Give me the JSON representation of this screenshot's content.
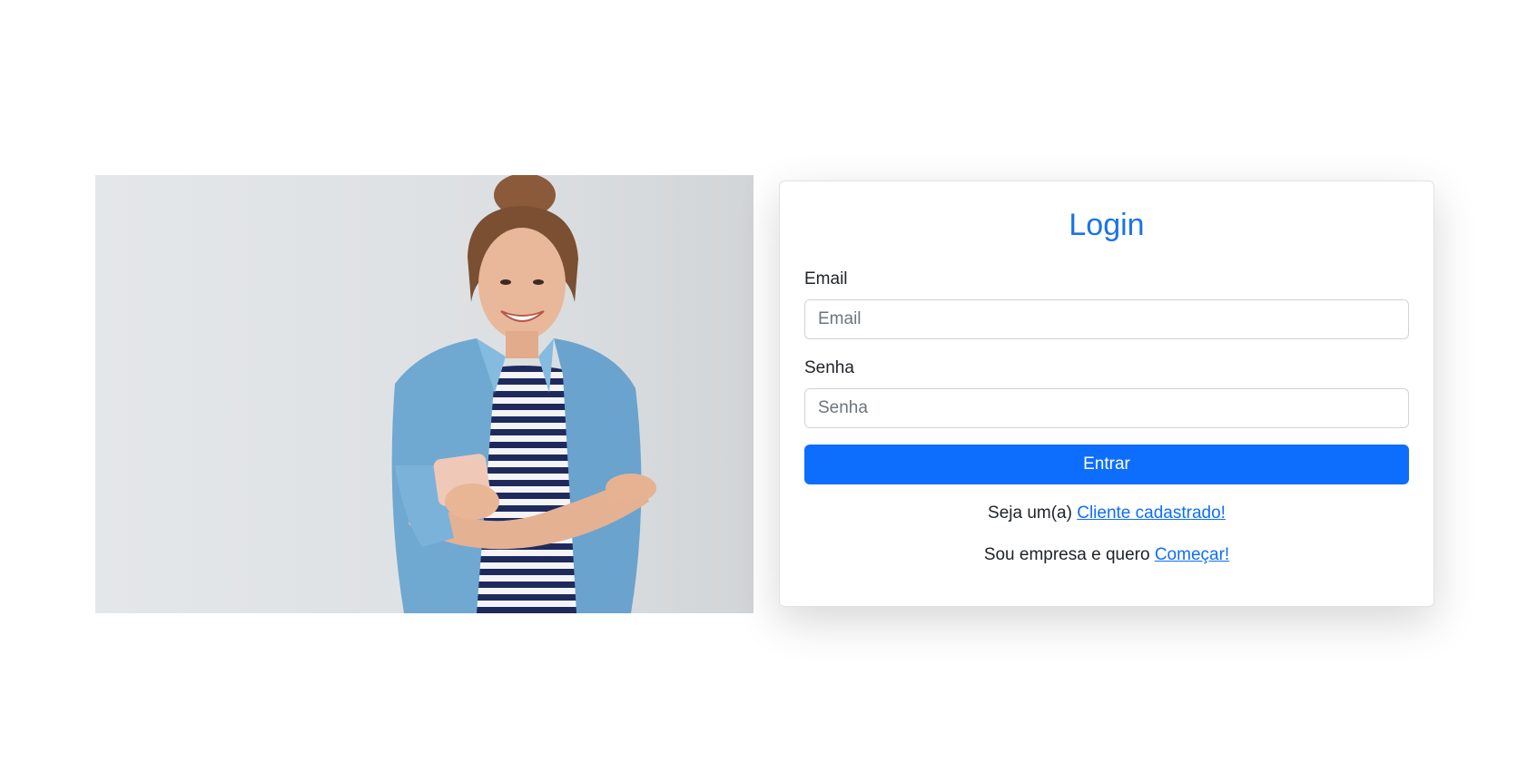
{
  "login": {
    "title": "Login",
    "email_label": "Email",
    "email_placeholder": "Email",
    "senha_label": "Senha",
    "senha_placeholder": "Senha",
    "submit_label": "Entrar",
    "cliente_prefix": "Seja um(a) ",
    "cliente_link": "Cliente cadastrado!",
    "empresa_prefix": "Sou empresa e quero ",
    "empresa_link": "Começar!"
  },
  "colors": {
    "accent": "#0d6efd",
    "title": "#1a73e8",
    "hero_background": "#e1e4e6"
  }
}
